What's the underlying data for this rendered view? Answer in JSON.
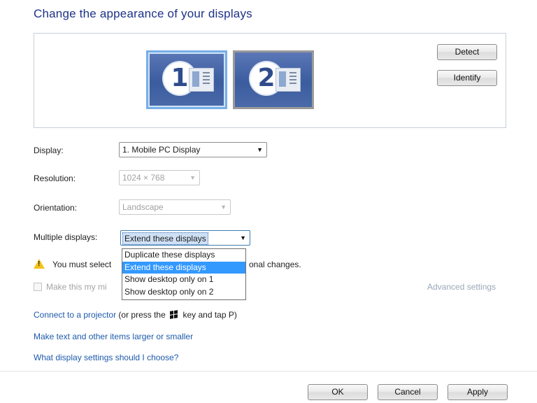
{
  "page": {
    "title": "Change the appearance of your displays"
  },
  "preview": {
    "monitors": [
      {
        "number": "1",
        "selected": true
      },
      {
        "number": "2",
        "selected": false
      }
    ],
    "detect_label": "Detect",
    "identify_label": "Identify"
  },
  "settings": {
    "display_label": "Display:",
    "display_value": "1. Mobile PC Display",
    "resolution_label": "Resolution:",
    "resolution_value": "1024 × 768",
    "orientation_label": "Orientation:",
    "orientation_value": "Landscape",
    "multiple_label": "Multiple displays:",
    "multiple_value": "Extend these displays",
    "multiple_options": [
      "Duplicate these displays",
      "Extend these displays",
      "Show desktop only on 1",
      "Show desktop only on 2"
    ]
  },
  "warning": {
    "text_start": "You must select",
    "text_end": "onal changes."
  },
  "main_display": {
    "label": "Make this my mi"
  },
  "advanced_label": "Advanced settings",
  "links": {
    "projector_link": "Connect to a projector",
    "projector_hint_start": "(or press the",
    "projector_hint_end": "key and tap P)",
    "text_size_link": "Make text and other items larger or smaller",
    "help_link": "What display settings should I choose?"
  },
  "footer": {
    "ok_label": "OK",
    "cancel_label": "Cancel",
    "apply_label": "Apply"
  },
  "colors": {
    "title": "#1e3287",
    "link": "#1d5aab",
    "highlight": "#3399ff",
    "warning": "#f2c21a"
  }
}
